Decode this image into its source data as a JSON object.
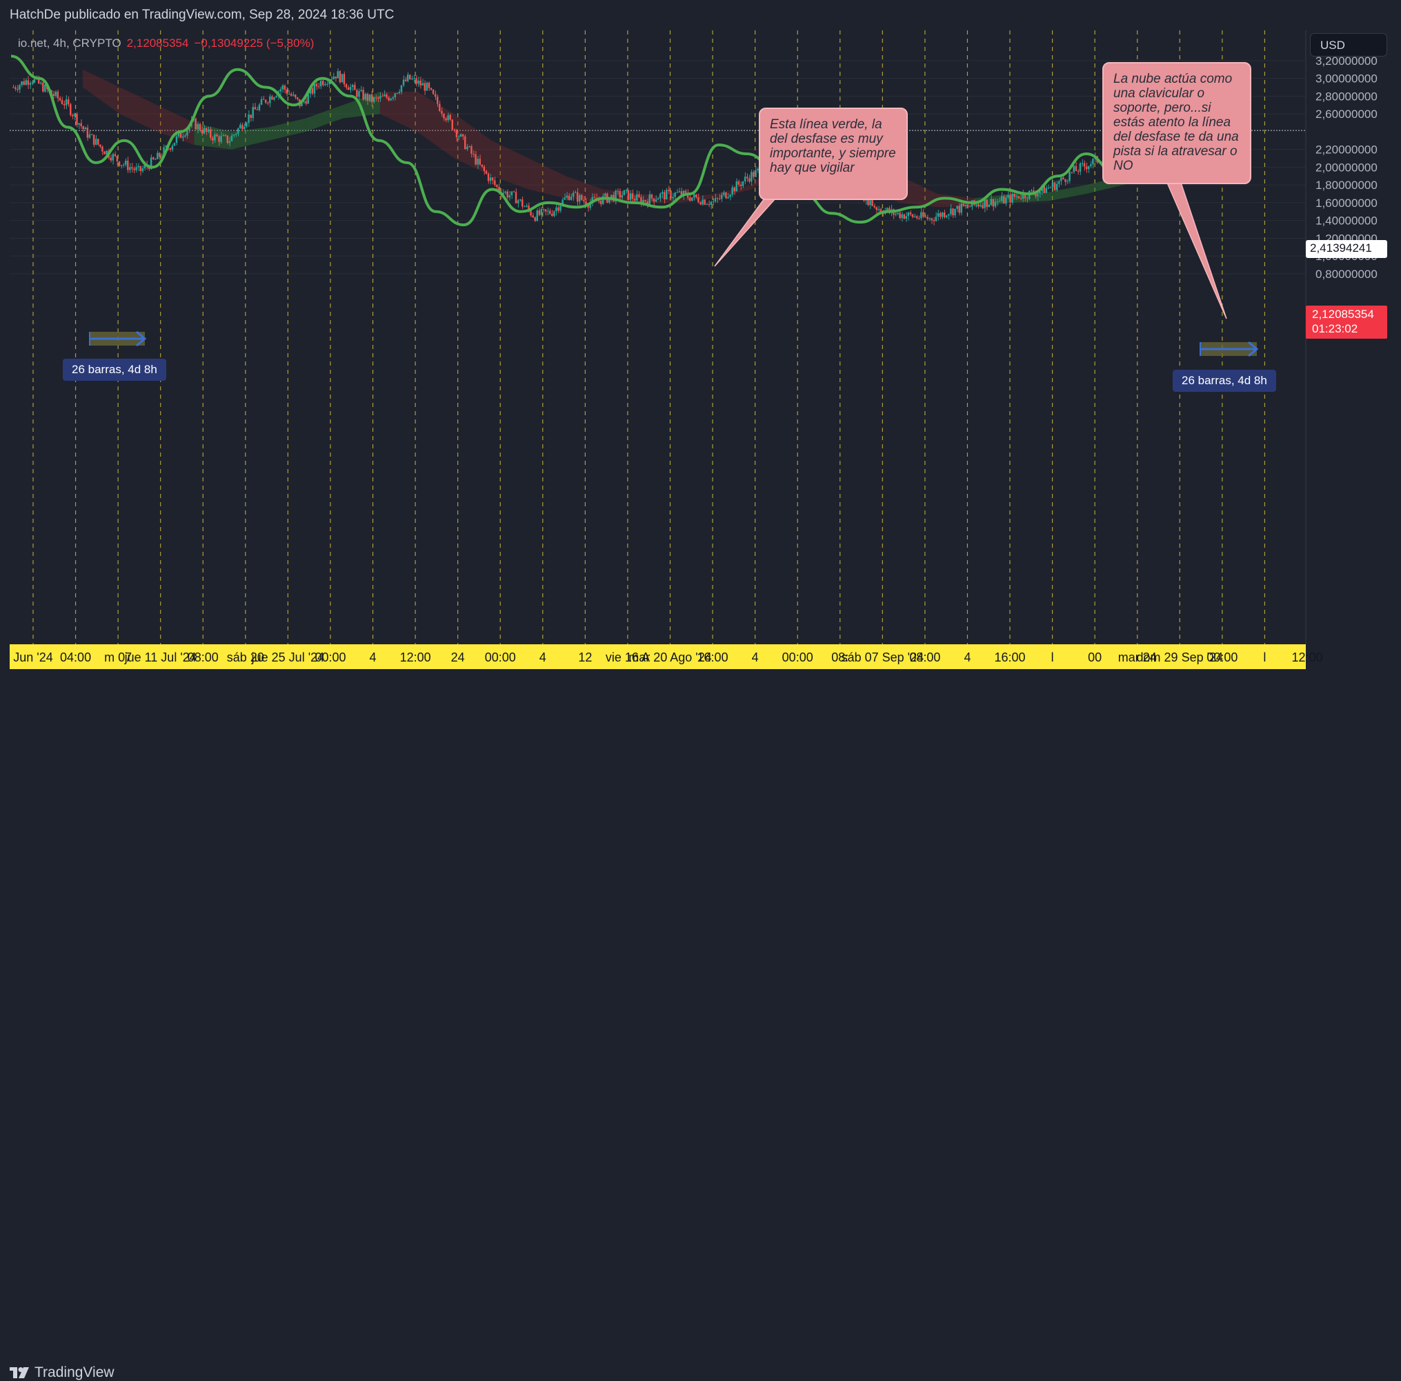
{
  "publisher": "HatchDe publicado en TradingView.com, Sep 28, 2024 18:36 UTC",
  "footer": {
    "logo_text": "TradingView"
  },
  "legend": {
    "symbol": "io.net, 4h, CRYPTO",
    "price": "2,12085354",
    "change": "−0,13049225 (−5,80%)"
  },
  "currency": "USD",
  "callouts": {
    "green_line": "Esta línea verde,  la del desfase es muy importante,  y siempre hay que vigilar",
    "cloud": "La nube actúa como una clavicular o soporte, pero...si estás atento la línea del desfase te da una pista si la atravesar o NO"
  },
  "measurements": [
    "26 barras, 4d 8h",
    "26 barras, 4d 8h"
  ],
  "price_tags": {
    "crosshair": "2,41394241",
    "last_price": "2,12085354",
    "countdown": "01:23:02"
  },
  "colors": {
    "background": "#1e222d",
    "grid": "#2a2e39",
    "vline": "#c9b53a",
    "up_candle": "#26a69a",
    "down_candle": "#ef5350",
    "lagging_span": "#4caf50",
    "cloud_bull": "#2e7d32",
    "cloud_bear": "#8b2a2a",
    "time_axis_bg": "#ffeb3b",
    "callout_bg": "#e8949b",
    "measure": "#3b6fd4",
    "last_price": "#f23645"
  },
  "chart_data": {
    "type": "candlestick",
    "title": "io.net, 4h, CRYPTO",
    "ylabel": "USD",
    "ylim": [
      0.65,
      3.3
    ],
    "y_ticks": [
      {
        "v": 3.2,
        "label": "3,20000000"
      },
      {
        "v": 3.0,
        "label": "3,00000000"
      },
      {
        "v": 2.8,
        "label": "2,80000000"
      },
      {
        "v": 2.6,
        "label": "2,60000000"
      },
      {
        "v": 2.2,
        "label": "2,20000000"
      },
      {
        "v": 2.0,
        "label": "2,00000000"
      },
      {
        "v": 1.8,
        "label": "1,80000000"
      },
      {
        "v": 1.6,
        "label": "1,60000000"
      },
      {
        "v": 1.4,
        "label": "1,40000000"
      },
      {
        "v": 1.2,
        "label": "1,20000000"
      },
      {
        "v": 1.0,
        "label": "1,00000000"
      },
      {
        "v": 0.8,
        "label": "0,80000000"
      }
    ],
    "x_ticks": [
      "Jun '24",
      "04:00",
      "m 07",
      "jue 11 Jul '24",
      "08:00",
      "sáb 20",
      "jue 25 Jul '24",
      "00:00",
      "4",
      "12:00",
      "24",
      "00:00",
      "4",
      "12",
      "vie 16 A",
      "mar 20 Ago '24",
      "16:00",
      "4",
      "00:00",
      "08:",
      "sáb 07 Sep '24",
      "08:00",
      "4",
      "16:00",
      "l",
      "00",
      "mar 24",
      "dom 29 Sep '24",
      "00:00",
      "l",
      "12:00"
    ],
    "price_path": [
      2.9,
      3.0,
      2.85,
      2.7,
      2.4,
      2.2,
      2.05,
      1.95,
      2.1,
      2.3,
      2.5,
      2.35,
      2.3,
      2.55,
      2.75,
      2.9,
      2.7,
      2.95,
      3.05,
      2.85,
      2.75,
      2.8,
      3.0,
      2.9,
      2.6,
      2.3,
      2.0,
      1.75,
      1.65,
      1.45,
      1.5,
      1.7,
      1.6,
      1.65,
      1.7,
      1.62,
      1.68,
      1.7,
      1.65,
      1.6,
      1.75,
      1.9,
      2.0,
      2.1,
      2.2,
      2.15,
      2.0,
      1.75,
      1.55,
      1.48,
      1.45,
      1.42,
      1.5,
      1.55,
      1.6,
      1.62,
      1.68,
      1.72,
      1.8,
      1.95,
      2.05,
      2.15,
      2.1,
      2.2,
      2.18,
      2.15,
      2.12
    ],
    "lagging_span": [
      3.25,
      3.0,
      2.45,
      2.05,
      2.3,
      2.0,
      2.4,
      2.8,
      3.1,
      2.9,
      2.7,
      3.0,
      2.8,
      2.3,
      2.05,
      1.5,
      1.35,
      1.75,
      1.5,
      1.6,
      1.55,
      1.65,
      1.6,
      1.55,
      1.7,
      2.25,
      2.15,
      2.0,
      1.7,
      1.48,
      1.38,
      1.5,
      1.55,
      1.65,
      1.6,
      1.75,
      1.7,
      1.9,
      2.15,
      1.95,
      2.2,
      2.25,
      2.2,
      2.1
    ],
    "cloud": {
      "upper": [
        3.1,
        2.9,
        2.7,
        2.5,
        2.4,
        2.45,
        2.55,
        2.7,
        2.85,
        2.85,
        2.6,
        2.3,
        2.1,
        1.9,
        1.75,
        1.7,
        1.65,
        1.7,
        1.8,
        2.2,
        2.25,
        2.0,
        1.9,
        1.7,
        1.65,
        1.7,
        1.72,
        1.8,
        1.9,
        2.0,
        2.1,
        2.15
      ],
      "lower": [
        2.9,
        2.6,
        2.4,
        2.25,
        2.2,
        2.3,
        2.4,
        2.55,
        2.6,
        2.4,
        2.1,
        1.9,
        1.75,
        1.65,
        1.6,
        1.6,
        1.6,
        1.65,
        1.75,
        2.05,
        2.0,
        1.75,
        1.6,
        1.55,
        1.55,
        1.6,
        1.62,
        1.7,
        1.8,
        1.9,
        2.0,
        2.05
      ],
      "bullish": [
        false,
        false,
        false,
        true,
        true,
        true,
        true,
        true,
        false,
        false,
        false,
        false,
        false,
        false,
        false,
        false,
        false,
        false,
        false,
        true,
        false,
        false,
        false,
        false,
        true,
        true,
        true,
        true,
        true,
        true,
        true,
        true
      ]
    },
    "measure_tool": {
      "label": "26 barras, 4d 8h",
      "bars": 26
    },
    "last_price": 2.12085354,
    "crosshair_price": 2.41394241
  }
}
